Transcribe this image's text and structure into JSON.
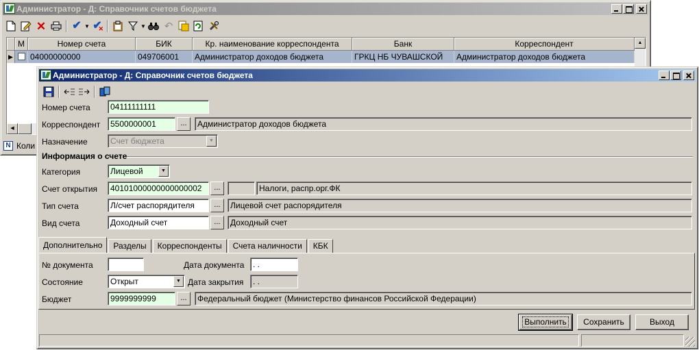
{
  "colors": {
    "window_face": "#d4d0c8",
    "active_title": "#0a246a",
    "inactive_title": "#808080",
    "required_field": "#e4ffe4",
    "selected_row": "#a6b4cc"
  },
  "back_window": {
    "title": "Администратор - Д: Справочник счетов бюджета",
    "toolbar_icons": [
      "new-document-icon",
      "edit-icon",
      "delete-icon",
      "print-icon",
      "check-icon",
      "dropdown-arrow-icon",
      "uncheck-icon",
      "clipboard-icon",
      "filter-icon",
      "dropdown-arrow-icon",
      "binoculars-icon",
      "undo-icon",
      "export-icon",
      "refresh-icon",
      "tools-icon"
    ],
    "grid": {
      "columns": [
        "M",
        "Номер счета",
        "БИК",
        "Кр. наименование корреспондента",
        "Банк",
        "Корреспондент"
      ],
      "rows": [
        {
          "account": "04000000000",
          "bik": "049706001",
          "short_name": "Администратор доходов бюджета",
          "bank": "ГРКЦ НБ ЧУВАШСКОЙ",
          "correspondent": "Администратор доходов бюджета"
        }
      ]
    },
    "status_text": "Коли"
  },
  "front_window": {
    "title": "Администратор - Д: Справочник счетов бюджета",
    "toolbar_icons": [
      "save-icon",
      "indent-left-icon",
      "indent-right-icon",
      "database-icon"
    ],
    "form": {
      "account_number": {
        "label": "Номер счета",
        "value": "04111111111"
      },
      "correspondent": {
        "label": "Корреспондент",
        "code": "5500000001",
        "name": "Администратор доходов бюджета"
      },
      "purpose": {
        "label": "Назначение",
        "value": "Счет бюджета"
      },
      "section_title": "Информация о счете",
      "category": {
        "label": "Категория",
        "value": "Лицевой"
      },
      "opening_account": {
        "label": "Счет открытия",
        "value": "40101000000000000002",
        "extra": "",
        "name": "Налоги, распр.орг.ФК"
      },
      "account_type": {
        "label": "Тип счета",
        "value": "Л/счет распорядителя",
        "name": "Лицевой счет распорядителя"
      },
      "account_kind": {
        "label": "Вид счета",
        "value": "Доходный счет",
        "name": "Доходный счет"
      }
    },
    "tabs": [
      "Дополнительно",
      "Разделы",
      "Корреспонденты",
      "Счета наличности",
      "КБК"
    ],
    "extra": {
      "doc_number": {
        "label": "№ документа",
        "value": ""
      },
      "doc_date": {
        "label": "Дата документа",
        "value": " .  ."
      },
      "state": {
        "label": "Состояние",
        "value": "Открыт"
      },
      "close_date": {
        "label": "Дата закрытия",
        "value": " .  ."
      },
      "budget": {
        "label": "Бюджет",
        "code": "9999999999",
        "name": "Федеральный бюджет (Министерство финансов Российской Федерации)"
      }
    },
    "buttons": {
      "execute": "Выполнить",
      "save": "Сохранить",
      "exit": "Выход"
    }
  }
}
